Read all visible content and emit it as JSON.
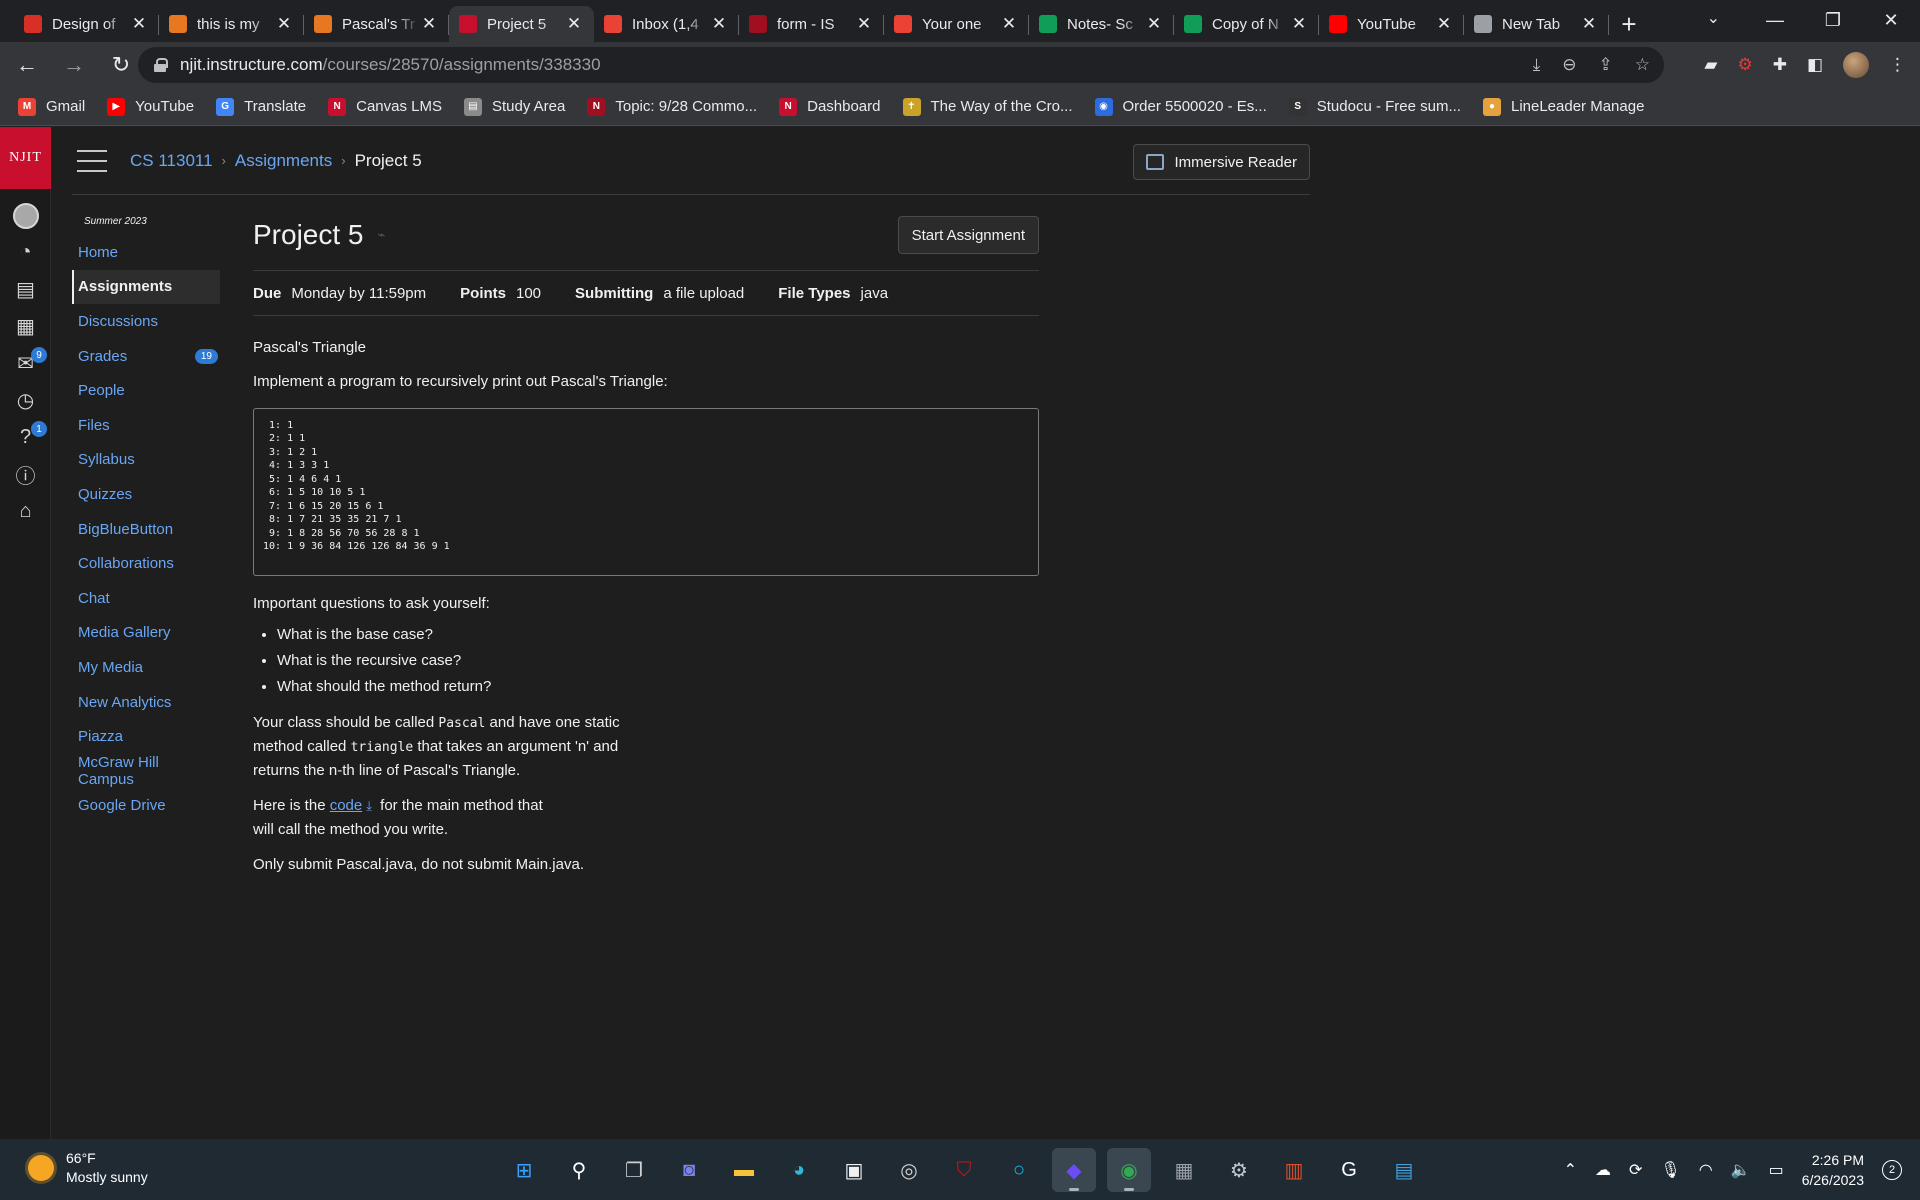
{
  "browser": {
    "tabs": [
      {
        "title": "Design of",
        "favicon": "red-doc",
        "color": "#d93025",
        "active": false
      },
      {
        "title": "this is my",
        "favicon": "chegg-c",
        "color": "#e87722",
        "active": false
      },
      {
        "title": "Pascal's Tr",
        "favicon": "chegg-c",
        "color": "#e87722",
        "active": false
      },
      {
        "title": "Project 5",
        "favicon": "njit",
        "color": "#c8102e",
        "active": true
      },
      {
        "title": "Inbox (1,4",
        "favicon": "gmail",
        "color": "#ea4335",
        "active": false
      },
      {
        "title": "form - IS",
        "favicon": "njit-red",
        "color": "#a00f20",
        "active": false
      },
      {
        "title": "Your one",
        "favicon": "gmail",
        "color": "#ea4335",
        "active": false
      },
      {
        "title": "Notes- Sc",
        "favicon": "sheets-plus",
        "color": "#0f9d58",
        "active": false
      },
      {
        "title": "Copy of N",
        "favicon": "sheets-plus",
        "color": "#0f9d58",
        "active": false
      },
      {
        "title": "YouTube",
        "favicon": "youtube",
        "color": "#ff0000",
        "active": false
      },
      {
        "title": "New Tab",
        "favicon": "chrome",
        "color": "#9aa0a6",
        "active": false
      }
    ],
    "url_host": "njit.instructure.com",
    "url_path": "/courses/28570/assignments/338330",
    "bookmarks": [
      {
        "label": "Gmail",
        "color": "#ea4335",
        "glyph": "M"
      },
      {
        "label": "YouTube",
        "color": "#ff0000",
        "glyph": "▶"
      },
      {
        "label": "Translate",
        "color": "#4285f4",
        "glyph": "G"
      },
      {
        "label": "Canvas LMS",
        "color": "#c8102e",
        "glyph": "N"
      },
      {
        "label": "Study Area",
        "color": "#8a8a8a",
        "glyph": "▤"
      },
      {
        "label": "Topic: 9/28 Commo...",
        "color": "#a00f20",
        "glyph": "N"
      },
      {
        "label": "Dashboard",
        "color": "#c8102e",
        "glyph": "N"
      },
      {
        "label": "The Way of the Cro...",
        "color": "#c9a227",
        "glyph": "✝"
      },
      {
        "label": "Order 5500020 - Es...",
        "color": "#2d6cdf",
        "glyph": "◉"
      },
      {
        "label": "Studocu - Free sum...",
        "color": "#333333",
        "glyph": "S"
      },
      {
        "label": "LineLeader Manage",
        "color": "#e6a23c",
        "glyph": "●"
      }
    ]
  },
  "canvas": {
    "logo": "NJIT",
    "global_nav": [
      {
        "icon": "account-icon",
        "glyph": "",
        "badge": ""
      },
      {
        "icon": "dashboard-icon",
        "glyph": "◔",
        "badge": ""
      },
      {
        "icon": "courses-icon",
        "glyph": "▤",
        "badge": ""
      },
      {
        "icon": "calendar-icon",
        "glyph": "▦",
        "badge": ""
      },
      {
        "icon": "inbox-icon",
        "glyph": "✉",
        "badge": "9"
      },
      {
        "icon": "history-icon",
        "glyph": "◷",
        "badge": ""
      },
      {
        "icon": "help-icon",
        "glyph": "?",
        "badge": "1"
      },
      {
        "icon": "info-icon",
        "glyph": "ⓘ",
        "badge": ""
      },
      {
        "icon": "accessibility-icon",
        "glyph": "⌂",
        "badge": ""
      }
    ],
    "breadcrumbs": [
      {
        "label": "CS 113011",
        "link": true
      },
      {
        "label": "Assignments",
        "link": true
      },
      {
        "label": "Project 5",
        "link": false
      }
    ],
    "immersive_reader": "Immersive Reader",
    "course_nav": {
      "term": "Summer 2023",
      "items": [
        {
          "label": "Home",
          "active": false,
          "badge": ""
        },
        {
          "label": "Assignments",
          "active": true,
          "badge": ""
        },
        {
          "label": "Discussions",
          "active": false,
          "badge": ""
        },
        {
          "label": "Grades",
          "active": false,
          "badge": "19"
        },
        {
          "label": "People",
          "active": false,
          "badge": ""
        },
        {
          "label": "Files",
          "active": false,
          "badge": ""
        },
        {
          "label": "Syllabus",
          "active": false,
          "badge": ""
        },
        {
          "label": "Quizzes",
          "active": false,
          "badge": ""
        },
        {
          "label": "BigBlueButton",
          "active": false,
          "badge": ""
        },
        {
          "label": "Collaborations",
          "active": false,
          "badge": ""
        },
        {
          "label": "Chat",
          "active": false,
          "badge": ""
        },
        {
          "label": "Media Gallery",
          "active": false,
          "badge": ""
        },
        {
          "label": "My Media",
          "active": false,
          "badge": ""
        },
        {
          "label": "New Analytics",
          "active": false,
          "badge": ""
        },
        {
          "label": "Piazza",
          "active": false,
          "badge": ""
        },
        {
          "label": "McGraw Hill Campus",
          "active": false,
          "badge": ""
        },
        {
          "label": "Google Drive",
          "active": false,
          "badge": ""
        }
      ]
    },
    "assignment": {
      "title": "Project 5",
      "start_button": "Start Assignment",
      "details": [
        {
          "key": "Due",
          "value": "Monday by 11:59pm"
        },
        {
          "key": "Points",
          "value": "100"
        },
        {
          "key": "Submitting",
          "value": "a file upload"
        },
        {
          "key": "File Types",
          "value": "java"
        }
      ],
      "heading": "Pascal's Triangle",
      "intro": "Implement a program to recursively print out Pascal's Triangle:",
      "code_lines": [
        " 1: 1",
        " 2: 1 1",
        " 3: 1 2 1",
        " 4: 1 3 3 1",
        " 5: 1 4 6 4 1",
        " 6: 1 5 10 10 5 1",
        " 7: 1 6 15 20 15 6 1",
        " 8: 1 7 21 35 35 21 7 1",
        " 9: 1 8 28 56 70 56 28 8 1",
        "10: 1 9 36 84 126 126 84 36 9 1"
      ],
      "questions_heading": "Important questions to ask yourself:",
      "questions": [
        "What is the base case?",
        "What is the recursive case?",
        "What should the method return?"
      ],
      "class_text_1": "Your class should be called ",
      "class_name": "Pascal",
      "class_text_2": " and have one static method called ",
      "method_name": "triangle",
      "class_text_3": " that takes an argument 'n' and returns the n-th line of Pascal's Triangle.",
      "code_text_1": "Here is the ",
      "code_link": "code",
      "code_text_2": " for the main method that will call the method you write.",
      "submit_note": "Only submit Pascal.java, do not submit Main.java."
    }
  },
  "taskbar": {
    "temperature": "66°F",
    "condition": "Mostly sunny",
    "apps": [
      {
        "icon": "windows-start-icon",
        "glyph": "⊞",
        "color": "#3aa0ff",
        "active": false
      },
      {
        "icon": "search-icon",
        "glyph": "⚲",
        "color": "#ffffff",
        "active": false
      },
      {
        "icon": "task-view-icon",
        "glyph": "❐",
        "color": "#d0d0d0",
        "active": false
      },
      {
        "icon": "chat-icon",
        "glyph": "◙",
        "color": "#7b83eb",
        "active": false
      },
      {
        "icon": "file-explorer-icon",
        "glyph": "▬",
        "color": "#f8c33a",
        "active": false
      },
      {
        "icon": "edge-icon",
        "glyph": "◕",
        "color": "#2fb8d8",
        "active": false
      },
      {
        "icon": "store-icon",
        "glyph": "▣",
        "color": "#f0f0f0",
        "active": false
      },
      {
        "icon": "dell-icon",
        "glyph": "◎",
        "color": "#d0d0d0",
        "active": false
      },
      {
        "icon": "mcafee-icon",
        "glyph": "⛉",
        "color": "#c01818",
        "active": false
      },
      {
        "icon": "alexa-icon",
        "glyph": "○",
        "color": "#1ab8f2",
        "active": false
      },
      {
        "icon": "webex-icon",
        "glyph": "◆",
        "color": "#6b4cf7",
        "active": true
      },
      {
        "icon": "chrome-icon",
        "glyph": "◉",
        "color": "#34a853",
        "active": true
      },
      {
        "icon": "calculator-icon",
        "glyph": "▦",
        "color": "#9aa0a6",
        "active": false
      },
      {
        "icon": "settings-icon",
        "glyph": "⚙",
        "color": "#c0c8d0",
        "active": false
      },
      {
        "icon": "winrar-icon",
        "glyph": "▥",
        "color": "#d94e2b",
        "active": false
      },
      {
        "icon": "grammarly-icon",
        "glyph": "G",
        "color": "#ffffff",
        "active": false
      },
      {
        "icon": "notepad-icon",
        "glyph": "▤",
        "color": "#40a0e0",
        "active": false
      }
    ],
    "time": "2:26 PM",
    "date": "6/26/2023",
    "notifications": "2"
  }
}
